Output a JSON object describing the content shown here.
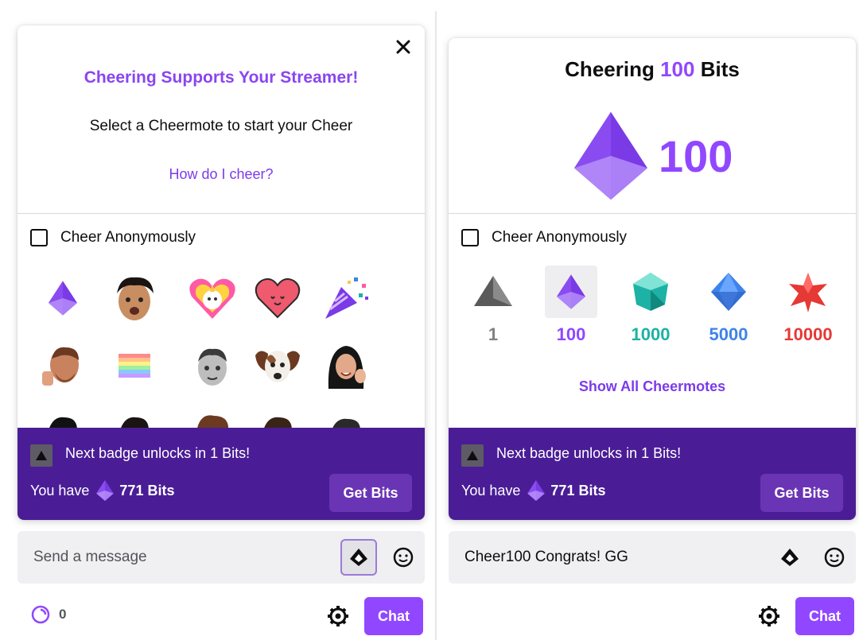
{
  "left": {
    "title": "Cheering Supports Your Streamer!",
    "subtitle": "Select a Cheermote to start your Cheer",
    "help_link": "How do I cheer?",
    "anon_label": "Cheer Anonymously",
    "emotes": [
      "bits-gem",
      "streamer-face-1",
      "unicorn-heart",
      "red-heart",
      "party-popper",
      "thumbs-up-guy",
      "rainbow-flag",
      "gray-face",
      "dog-face",
      "waving-woman",
      "face-partial-1",
      "face-partial-2",
      "face-partial-3",
      "face-partial-4",
      "face-partial-5"
    ],
    "footer": {
      "next_badge": "Next badge unlocks in 1 Bits!",
      "you_have": "You have",
      "bits": "771 Bits",
      "get_bits": "Get Bits"
    },
    "message_placeholder": "Send a message",
    "points": "0",
    "chat_button": "Chat"
  },
  "right": {
    "title_pre": "Cheering",
    "title_num": "100",
    "title_post": "Bits",
    "big_amount": "100",
    "anon_label": "Cheer Anonymously",
    "tiers": [
      {
        "label": "1",
        "color": "#828282",
        "icon": "gray-triangle"
      },
      {
        "label": "100",
        "color": "#9147ff",
        "icon": "purple-gem"
      },
      {
        "label": "1000",
        "color": "#1db2a5",
        "icon": "teal-gem"
      },
      {
        "label": "5000",
        "color": "#3e83ea",
        "icon": "blue-gem"
      },
      {
        "label": "10000",
        "color": "#e53935",
        "icon": "red-star"
      }
    ],
    "show_all": "Show All Cheermotes",
    "footer": {
      "next_badge": "Next badge unlocks in 1 Bits!",
      "you_have": "You have",
      "bits": "771 Bits",
      "get_bits": "Get Bits"
    },
    "message_text": "Cheer100 Congrats! GG",
    "chat_button": "Chat"
  },
  "colors": {
    "brand": "#9147ff",
    "footer": "#4a1d96",
    "get_bits_bg": "#6a35b4"
  }
}
